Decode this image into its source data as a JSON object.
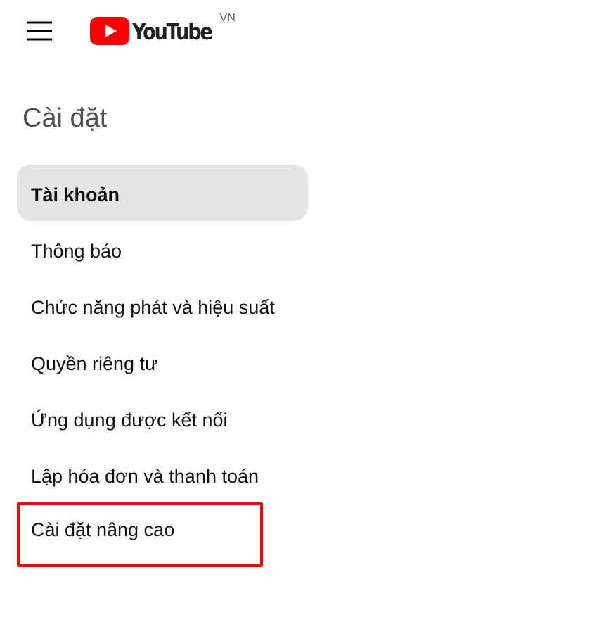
{
  "header": {
    "logo_text": "YouTube",
    "region": "VN"
  },
  "sidebar": {
    "title": "Cài đặt",
    "items": [
      {
        "label": "Tài khoản",
        "selected": true,
        "highlighted": false
      },
      {
        "label": "Thông báo",
        "selected": false,
        "highlighted": false
      },
      {
        "label": "Chức năng phát và hiệu suất",
        "selected": false,
        "highlighted": false
      },
      {
        "label": "Quyền riêng tư",
        "selected": false,
        "highlighted": false
      },
      {
        "label": "Ứng dụng được kết nối",
        "selected": false,
        "highlighted": false
      },
      {
        "label": "Lập hóa đơn và thanh toán",
        "selected": false,
        "highlighted": false
      },
      {
        "label": "Cài đặt nâng cao",
        "selected": false,
        "highlighted": true
      }
    ]
  }
}
